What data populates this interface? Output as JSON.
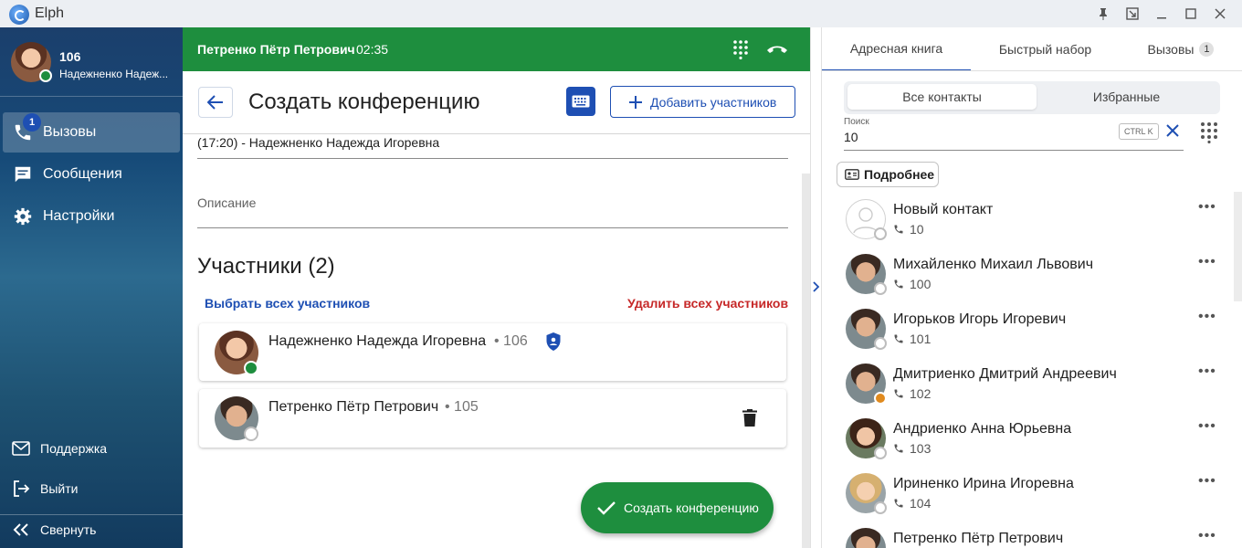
{
  "app": {
    "title": "Elph"
  },
  "user": {
    "number": "106",
    "name": "Надежненко Надеж..."
  },
  "nav": {
    "calls": {
      "label": "Вызовы",
      "badge": "1"
    },
    "messages": {
      "label": "Сообщения"
    },
    "settings": {
      "label": "Настройки"
    }
  },
  "sidebar_bottom": {
    "support": "Поддержка",
    "logout": "Выйти",
    "collapse": "Свернуть"
  },
  "call_bar": {
    "caller": "Петренко Пётр Петрович",
    "duration": "02:35"
  },
  "page": {
    "title": "Создать конференцию",
    "add_participants": "Добавить участников",
    "subject_value": "(17:20) - Надежненко Надежда Игоревна",
    "description_label": "Описание",
    "participants_heading": "Участники (2)",
    "select_all": "Выбрать всех участников",
    "delete_all": "Удалить всех участников",
    "create_button": "Создать конференцию"
  },
  "participants": [
    {
      "name": "Надежненко Надежда Игоревна",
      "ext": "• 106"
    },
    {
      "name": "Петренко Пётр Петрович",
      "ext": "• 105"
    }
  ],
  "right": {
    "tabs": {
      "address_book": "Адресная книга",
      "speed_dial": "Быстрый набор",
      "calls": "Вызовы",
      "calls_badge": "1"
    },
    "segments": {
      "all": "Все контакты",
      "favorites": "Избранные"
    },
    "search": {
      "label": "Поиск",
      "value": "10",
      "shortcut": "CTRL K"
    },
    "details_button": "Подробнее",
    "more_glyph": "•••",
    "contacts": [
      {
        "name": "Новый контакт",
        "phone": "10"
      },
      {
        "name": "Михайленко Михаил Львович",
        "phone": "100"
      },
      {
        "name": "Игорьков Игорь Игоревич",
        "phone": "101"
      },
      {
        "name": "Дмитриенко Дмитрий Андреевич",
        "phone": "102"
      },
      {
        "name": "Андриенко Анна Юрьевна",
        "phone": "103"
      },
      {
        "name": "Ириненко Ирина Игоревна",
        "phone": "104"
      },
      {
        "name": "Петренко Пётр Петрович",
        "phone": ""
      }
    ]
  },
  "colors": {
    "accent": "#1e4fb3",
    "call_green": "#1e8e3e",
    "danger": "#c62828",
    "sidebar": "#1b3f6c"
  }
}
